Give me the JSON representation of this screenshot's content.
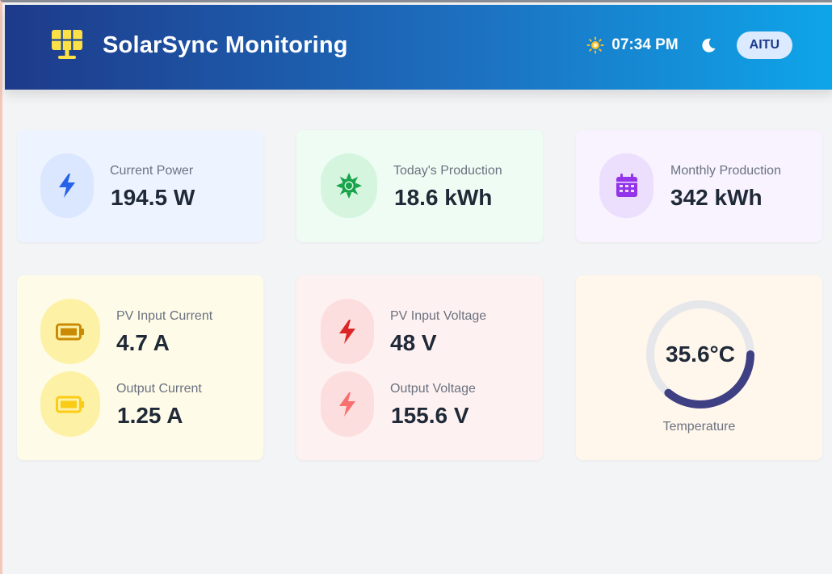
{
  "header": {
    "title": "SolarSync Monitoring",
    "time": "07:34 PM",
    "user_label": "AITU",
    "logo_icon": "solar-panel-icon",
    "theme_icon": "moon-icon"
  },
  "stats": {
    "current_power": {
      "label": "Current Power",
      "value": "194.5 W",
      "icon": "bolt-icon"
    },
    "todays_production": {
      "label": "Today's Production",
      "value": "18.6 kWh",
      "icon": "sun-icon"
    },
    "monthly_production": {
      "label": "Monthly Production",
      "value": "342 kWh",
      "icon": "calendar-icon"
    },
    "pv_input_current": {
      "label": "PV Input Current",
      "value": "4.7 A",
      "icon": "battery-icon"
    },
    "output_current": {
      "label": "Output Current",
      "value": "1.25 A",
      "icon": "battery-icon"
    },
    "pv_input_voltage": {
      "label": "PV Input Voltage",
      "value": "48 V",
      "icon": "bolt-icon"
    },
    "output_voltage": {
      "label": "Output Voltage",
      "value": "155.6 V",
      "icon": "bolt-icon"
    },
    "temperature": {
      "label": "Temperature",
      "value": "35.6°C",
      "gauge_fraction": 0.36
    }
  },
  "colors": {
    "header_start": "#1e3a8a",
    "header_end": "#0ea5e9",
    "gauge_fill": "#3f3f83",
    "gauge_track": "#e5e7eb"
  }
}
